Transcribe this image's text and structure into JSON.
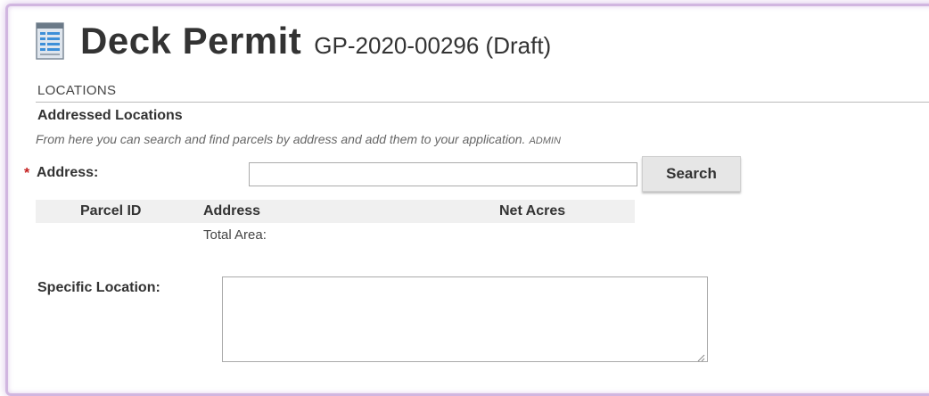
{
  "header": {
    "title": "Deck Permit",
    "record_id": "GP-2020-00296 (Draft)"
  },
  "section": {
    "title": "LOCATIONS",
    "subsection_title": "Addressed Locations",
    "help_text": "From here you can search and find parcels by address and add them to your application.",
    "admin_tag": "ADMIN"
  },
  "address": {
    "required_marker": "*",
    "label": "Address:",
    "value": "",
    "search_label": "Search"
  },
  "parcel_table": {
    "columns": [
      "Parcel ID",
      "Address",
      "Net Acres"
    ],
    "total_label": "Total Area:"
  },
  "specific_location": {
    "label": "Specific Location:",
    "value": ""
  },
  "colors": {
    "frame_glow": "#d1b6e0",
    "required": "#c41e1e",
    "button_bg": "#e6e6e6",
    "table_header_bg": "#f0f0f0"
  },
  "icons": {
    "header_icon": "document-icon"
  }
}
